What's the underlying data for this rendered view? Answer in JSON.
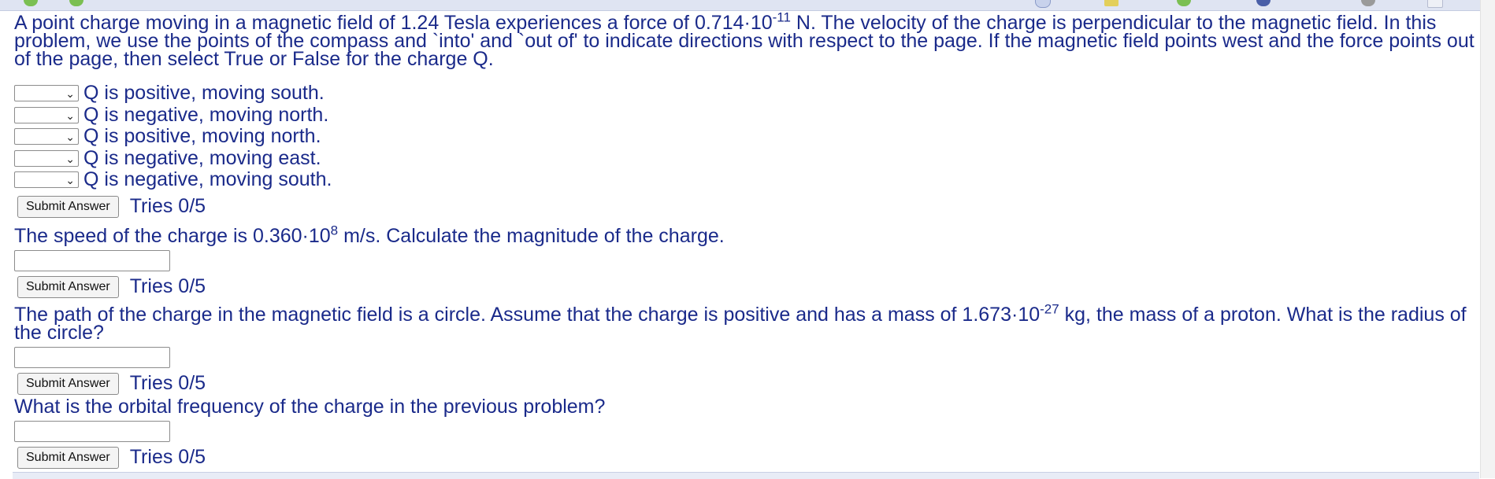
{
  "problem": {
    "intro_1": "A point charge moving in a magnetic field of 1.24 Tesla experiences a force of 0.714·10",
    "intro_exp": "-11",
    "intro_2": " N. The velocity of the charge is perpendicular to the magnetic field. In this problem, we use the points of the compass and `into' and `out of' to indicate directions with respect to the page. If the magnetic field points west and the force points out of the page, then select True or False for the charge Q."
  },
  "choices": [
    {
      "selected": "",
      "label": "Q is positive, moving south."
    },
    {
      "selected": "",
      "label": "Q is negative, moving north."
    },
    {
      "selected": "",
      "label": "Q is positive, moving north."
    },
    {
      "selected": "",
      "label": "Q is negative, moving east."
    },
    {
      "selected": "",
      "label": "Q is negative, moving south."
    }
  ],
  "submit_label": "Submit Answer",
  "tries": "Tries 0/5",
  "part2": {
    "text_1": "The speed of the charge is 0.360·10",
    "exp": "8",
    "text_2": " m/s. Calculate the magnitude of the charge.",
    "answer": ""
  },
  "part3": {
    "text_1": "The path of the charge in the magnetic field is a circle. Assume that the charge is positive and has a mass of 1.673·10",
    "exp": "-27",
    "text_2": " kg, the mass of a proton. What is the radius of the circle?",
    "answer": ""
  },
  "part4": {
    "text": "What is the orbital frequency of the charge in the previous problem?",
    "answer": ""
  },
  "icons": {
    "chevron": "chevron-down-icon"
  }
}
